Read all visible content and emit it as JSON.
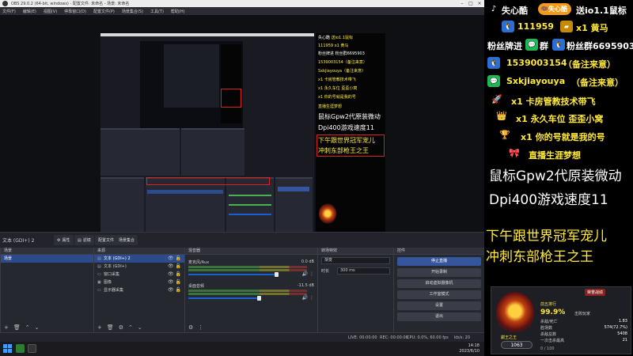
{
  "window": {
    "title": "OBS 29.0.2 (64-bit, windows) - 配置文件: 未命名 - 场景: 未命名",
    "menu": [
      "文件(F)",
      "编辑(E)",
      "视图(V)",
      "停靠窗口(D)",
      "配置文件(P)",
      "场景集合(S)",
      "工具(T)",
      "帮助(H)"
    ]
  },
  "dock_controls": {
    "scene_label": "文本 (GDI+) 2",
    "buttons": [
      "属性",
      "滤镜",
      "配置文件",
      "场景集合"
    ]
  },
  "panels": {
    "scenes": {
      "title": "场景",
      "items": [
        "场景"
      ]
    },
    "sources": {
      "title": "来源",
      "items": [
        {
          "label": "文本 (GDI+) 2",
          "selected": true
        },
        {
          "label": "文本 (GDI+)",
          "selected": false
        },
        {
          "label": "窗口采集",
          "selected": false
        },
        {
          "label": "图像",
          "selected": false
        },
        {
          "label": "显示器采集",
          "selected": false
        }
      ]
    },
    "mixer": {
      "title": "混音器",
      "channels": [
        {
          "name": "麦克风/Aux",
          "db": "0.0 dB",
          "level": 0.78
        },
        {
          "name": "桌面音频",
          "db": "-11.5 dB",
          "level": 0.62
        }
      ]
    },
    "transitions": {
      "title": "转场特效",
      "type": "渐变",
      "duration_label": "时长",
      "duration": "300 ms"
    },
    "controls": {
      "title": "控件",
      "buttons": [
        {
          "label": "停止直播",
          "active": true
        },
        {
          "label": "开始录制",
          "active": false
        },
        {
          "label": "启动虚拟摄像机",
          "active": false
        },
        {
          "label": "工作室模式",
          "active": false
        },
        {
          "label": "设置",
          "active": false
        },
        {
          "label": "退出",
          "active": false
        }
      ]
    }
  },
  "statusbar": {
    "live": "LIVE: 00:00:00",
    "rec": "REC: 00:00:00",
    "cpu": "CPU: 0.0%, 60.00 fps",
    "kbps": "kb/s: 20"
  },
  "taskbar": {
    "time": "14:18",
    "date": "2023/6/10"
  },
  "overlay": {
    "line1": {
      "name": "失心酷",
      "tag": "失心酷",
      "gift": "送io1.1鼠标"
    },
    "line2": {
      "qq": "111959",
      "gift": "x1 黄马"
    },
    "line3": {
      "a": "粉丝牌进",
      "b": "群",
      "c": "粉丝群6695903"
    },
    "line4": {
      "num": "1539003154",
      "note": "（备注来意）"
    },
    "line5": {
      "id": "Sxkjiayouya",
      "note": "（备注来意）"
    },
    "line6": "x1 卡房管教技术带飞",
    "line7": "x1 永久车位 歪歪小窝",
    "line8": "x1 你的号就是我的号",
    "line9": "直播生涯梦想",
    "big1": "鼠标Gpw2代原装微动",
    "big2": "Dpi400游戏速度11",
    "big3": "下午跟世界冠军宠儿",
    "big4": "冲刺东部枪王之王"
  },
  "game_panel": {
    "tab": "荣誉战绩",
    "rank_title": "巅王之王",
    "rank_label": "前五排行",
    "rank_pct": "99.9%",
    "rank_suffix": "击败玩家",
    "score": "1063",
    "stats": [
      {
        "k": "杀敌/死亡",
        "v": "1.83"
      },
      {
        "k": "胜场数",
        "v": "574(72.7%)"
      },
      {
        "k": "杀敌总数",
        "v": "5408"
      },
      {
        "k": "一次击杀最高",
        "v": "21"
      }
    ],
    "progress": "0 / 100"
  }
}
